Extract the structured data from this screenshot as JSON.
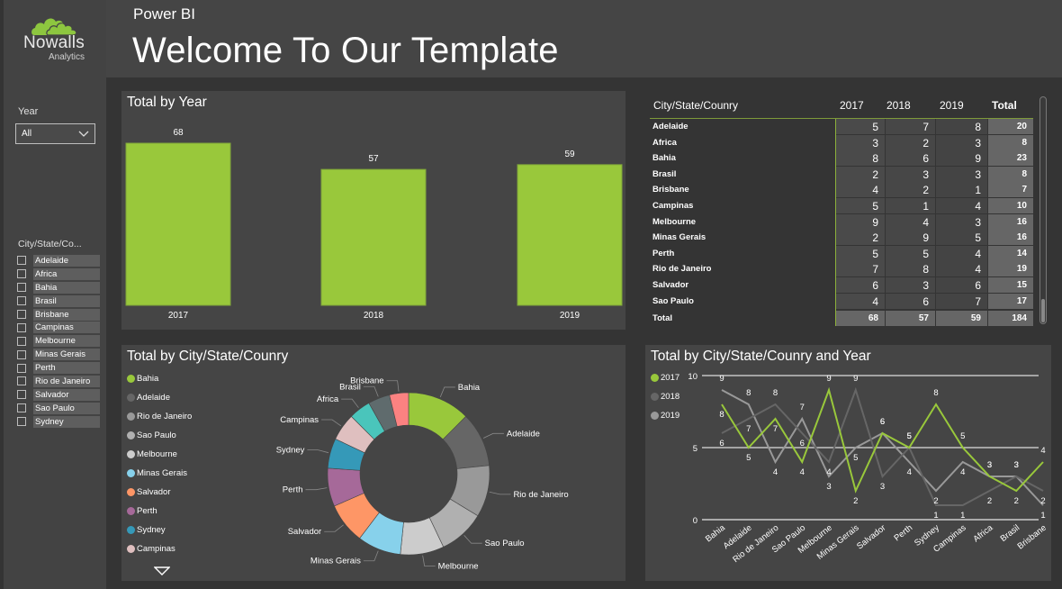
{
  "sidebar": {
    "logo_name": "Nowalls",
    "logo_sub": "Analytics",
    "year_slicer": {
      "label": "Year",
      "selected": "All"
    },
    "city_slicer": {
      "label": "City/State/Co...",
      "items": [
        "Adelaide",
        "Africa",
        "Bahia",
        "Brasil",
        "Brisbane",
        "Campinas",
        "Melbourne",
        "Minas Gerais",
        "Perth",
        "Rio de Janeiro",
        "Salvador",
        "Sao Paulo",
        "Sydney"
      ]
    }
  },
  "header": {
    "app": "Power BI",
    "title": "Welcome To Our Template"
  },
  "colors": {
    "accent": "#99c83b",
    "bg": "#343434",
    "panel": "#454545"
  },
  "matrix": {
    "headers": {
      "city": "City/State/Counry",
      "y2017": "2017",
      "y2018": "2018",
      "y2019": "2019",
      "total": "Total"
    },
    "rows": [
      {
        "name": "Adelaide",
        "v": [
          "5",
          "7",
          "8"
        ],
        "total": "20"
      },
      {
        "name": "Africa",
        "v": [
          "3",
          "2",
          "3"
        ],
        "total": "8"
      },
      {
        "name": "Bahia",
        "v": [
          "8",
          "6",
          "9"
        ],
        "total": "23"
      },
      {
        "name": "Brasil",
        "v": [
          "2",
          "3",
          "3"
        ],
        "total": "8"
      },
      {
        "name": "Brisbane",
        "v": [
          "4",
          "2",
          "1"
        ],
        "total": "7"
      },
      {
        "name": "Campinas",
        "v": [
          "5",
          "1",
          "4"
        ],
        "total": "10"
      },
      {
        "name": "Melbourne",
        "v": [
          "9",
          "4",
          "3"
        ],
        "total": "16"
      },
      {
        "name": "Minas Gerais",
        "v": [
          "2",
          "9",
          "5"
        ],
        "total": "16"
      },
      {
        "name": "Perth",
        "v": [
          "5",
          "5",
          "4"
        ],
        "total": "14"
      },
      {
        "name": "Rio de Janeiro",
        "v": [
          "7",
          "8",
          "4"
        ],
        "total": "19"
      },
      {
        "name": "Salvador",
        "v": [
          "6",
          "3",
          "6"
        ],
        "total": "15"
      },
      {
        "name": "Sao Paulo",
        "v": [
          "4",
          "6",
          "7"
        ],
        "total": "17"
      }
    ],
    "total_row": {
      "name": "Total",
      "v": [
        "68",
        "57",
        "59"
      ],
      "total": "184"
    }
  },
  "chart_data": [
    {
      "id": "total-by-year",
      "type": "bar",
      "title": "Total by Year",
      "categories": [
        "2017",
        "2018",
        "2019"
      ],
      "values": [
        68,
        57,
        59
      ],
      "ylim": [
        0,
        68
      ],
      "color": "#99c83b",
      "data_labels": true,
      "grid": false
    },
    {
      "id": "total-by-city",
      "type": "pie",
      "donut": true,
      "title": "Total by City/State/Counry",
      "labels": [
        "Bahia",
        "Adelaide",
        "Rio de Janeiro",
        "Sao Paulo",
        "Melbourne",
        "Minas Gerais",
        "Salvador",
        "Perth",
        "Sydney",
        "Campinas",
        "Africa",
        "Brasil",
        "Brisbane"
      ],
      "values": [
        23,
        20,
        19,
        17,
        16,
        16,
        15,
        14,
        11,
        10,
        8,
        8,
        7
      ],
      "colors": [
        "#99c83b",
        "#666666",
        "#999999",
        "#b0b0b0",
        "#cccccc",
        "#87d1eb",
        "#fe9666",
        "#a66999",
        "#3599b8",
        "#dfbfbf",
        "#4ac5bb",
        "#5f6b6d",
        "#fb8281"
      ],
      "legend_visible": [
        "Bahia",
        "Adelaide",
        "Rio de Janeiro",
        "Sao Paulo",
        "Melbourne",
        "Minas Gerais",
        "Salvador",
        "Perth",
        "Sydney",
        "Campinas"
      ],
      "legend_position": "left"
    },
    {
      "id": "total-by-city-and-year",
      "type": "line",
      "title": "Total by City/State/Counry and Year",
      "categories": [
        "Bahia",
        "Adelaide",
        "Rio de Janeiro",
        "Sao Paulo",
        "Melbourne",
        "Minas Gerais",
        "Salvador",
        "Perth",
        "Sydney",
        "Campinas",
        "Africa",
        "Brasil",
        "Brisbane"
      ],
      "series": [
        {
          "name": "2017",
          "color": "#99c83b",
          "values": [
            8,
            5,
            7,
            4,
            9,
            2,
            6,
            5,
            8,
            5,
            3,
            2,
            4
          ]
        },
        {
          "name": "2018",
          "color": "#666666",
          "values": [
            6,
            7,
            8,
            6,
            4,
            9,
            3,
            5,
            1,
            1,
            2,
            3,
            2
          ]
        },
        {
          "name": "2019",
          "color": "#999999",
          "values": [
            9,
            8,
            4,
            7,
            3,
            5,
            6,
            4,
            2,
            4,
            3,
            3,
            1
          ]
        }
      ],
      "yticks": [
        "0",
        "5",
        "10"
      ],
      "ylim": [
        0,
        10
      ],
      "grid": true,
      "legend_position": "left"
    }
  ]
}
